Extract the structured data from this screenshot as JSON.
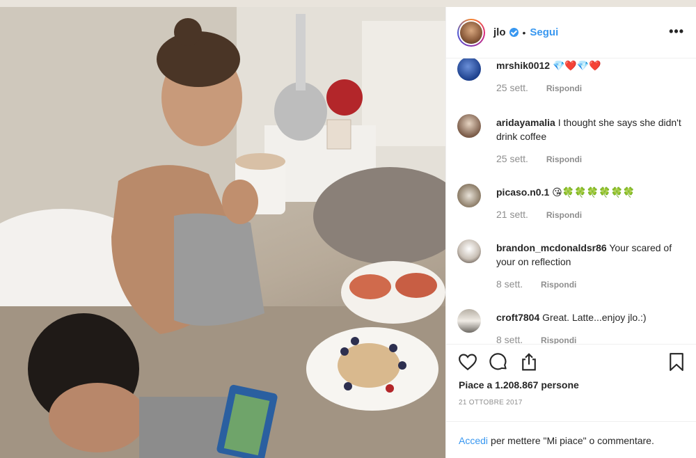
{
  "post": {
    "username": "jlo",
    "separator": "•",
    "follow_label": "Segui",
    "more_label": "•••"
  },
  "comments": [
    {
      "user": "mrshik0012",
      "text": "💎❤️💎❤️",
      "time": "25 sett.",
      "reply_label": "Rispondi"
    },
    {
      "user": "aridayamalia",
      "text": "I thought she says she didn't drink coffee",
      "time": "25 sett.",
      "reply_label": "Rispondi"
    },
    {
      "user": "picaso.n0.1",
      "text": "😘🍀🍀🍀🍀🍀🍀",
      "time": "21 sett.",
      "reply_label": "Rispondi"
    },
    {
      "user": "brandon_mcdonaldsr86",
      "text": "Your scared of your on reflection",
      "time": "8 sett.",
      "reply_label": "Rispondi"
    },
    {
      "user": "croft7804",
      "text": "Great. Latte...enjoy jlo.:)",
      "time": "8 sett.",
      "reply_label": "Rispondi"
    }
  ],
  "actions": {
    "icons": [
      "heart-icon",
      "comment-icon",
      "share-icon",
      "bookmark-icon"
    ],
    "likes_text": "Piace a 1.208.867 persone",
    "date": "21 OTTOBRE 2017"
  },
  "login": {
    "link": "Accedi",
    "text": "per mettere \"Mi piace\" o commentare."
  },
  "colors": {
    "accent": "#3897f0",
    "text": "#262626",
    "muted": "#8e8e8e",
    "border": "#efefef"
  }
}
